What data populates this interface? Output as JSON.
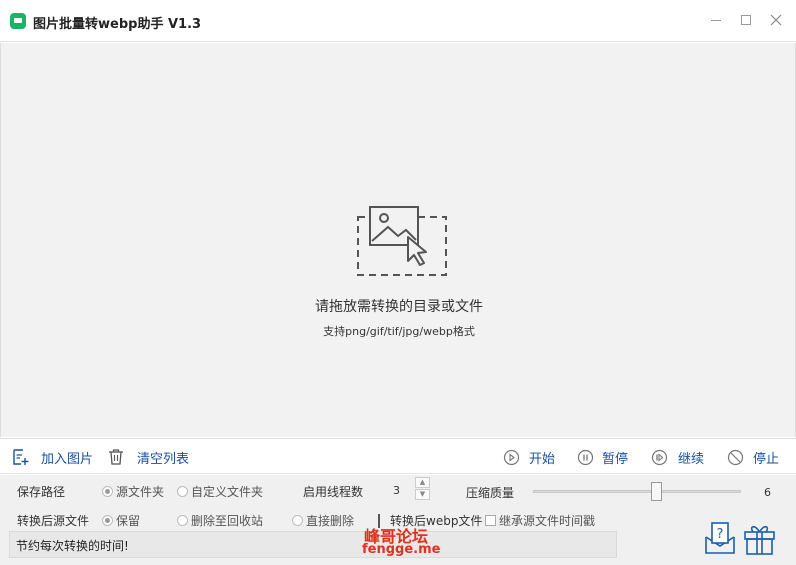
{
  "window": {
    "title": "图片批量转webp助手 V1.3",
    "minimize_icon": "minimize-icon",
    "maximize_icon": "maximize-icon",
    "close_icon": "close-icon"
  },
  "dropzone": {
    "icon": "image-drop-icon",
    "main_text": "请拖放需转换的目录或文件",
    "sub_text": "支持png/gif/tif/jpg/webp格式"
  },
  "toolbar": {
    "add_images": "加入图片",
    "clear_list": "清空列表",
    "start": "开始",
    "pause": "暂停",
    "resume": "继续",
    "stop": "停止"
  },
  "settings": {
    "save_path_label": "保存路径",
    "save_path_options": [
      "源文件夹",
      "自定义文件夹"
    ],
    "save_path_selected": 0,
    "threads_label": "启用线程数",
    "threads_value": "3",
    "quality_label": "压缩质量",
    "quality_value": "6",
    "after_convert_label": "转换后源文件",
    "after_convert_options": [
      "保留",
      "删除至回收站",
      "直接删除"
    ],
    "after_convert_selected": 0,
    "converted_webp_label": "转换后webp文件",
    "inherit_time_label": "继承源文件时间戳",
    "inherit_time_checked": false,
    "status_text": "节约每次转换的时间!"
  },
  "watermark": {
    "line1": "峰哥论坛",
    "line2": "fengge.me"
  },
  "colors": {
    "accent": "#1a4f9a",
    "brand_green": "#18b566",
    "watermark": "#e0301e"
  }
}
